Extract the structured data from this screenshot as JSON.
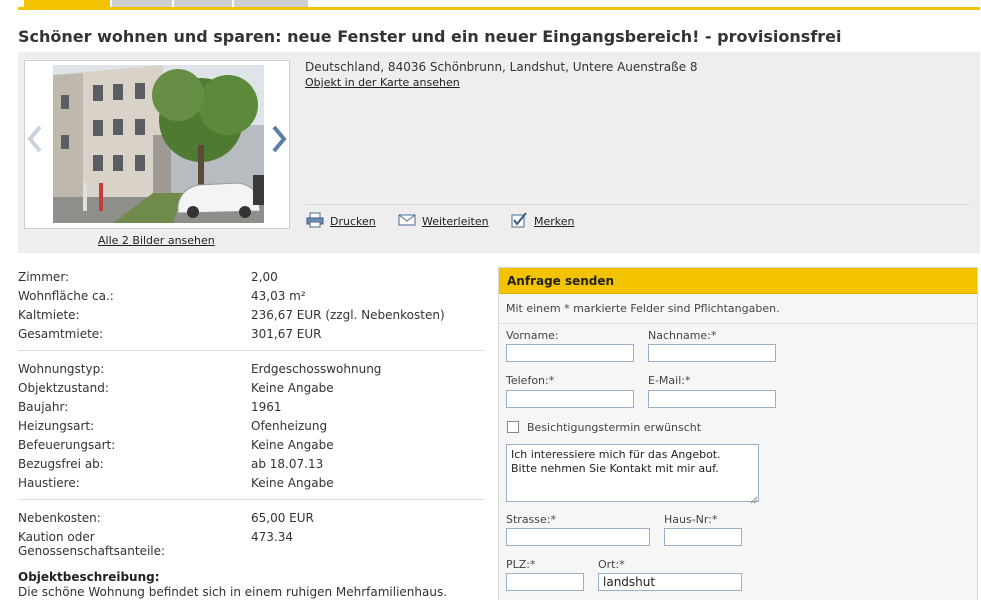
{
  "listing": {
    "title": "Schöner wohnen und sparen: neue Fenster und ein neuer Eingangsbereich! - provisionsfrei",
    "address": "Deutschland, 84036 Schönbrunn, Landshut, Untere Auenstraße 8",
    "map_link": "Objekt in der Karte ansehen",
    "all_images_link": "Alle 2 Bilder ansehen"
  },
  "actions": {
    "print": "Drucken",
    "forward": "Weiterleiten",
    "remember": "Merken"
  },
  "details": {
    "group1": [
      {
        "label": "Zimmer:",
        "value": "2,00"
      },
      {
        "label": "Wohnfläche ca.:",
        "value": "43,03 m²"
      },
      {
        "label": "Kaltmiete:",
        "value": "236,67 EUR (zzgl. Nebenkosten)"
      },
      {
        "label": "Gesamtmiete:",
        "value": "301,67 EUR"
      }
    ],
    "group2": [
      {
        "label": "Wohnungstyp:",
        "value": "Erdgeschosswohnung"
      },
      {
        "label": "Objektzustand:",
        "value": "Keine Angabe"
      },
      {
        "label": "Baujahr:",
        "value": "1961"
      },
      {
        "label": "Heizungsart:",
        "value": "Ofenheizung"
      },
      {
        "label": "Befeuerungsart:",
        "value": "Keine Angabe"
      },
      {
        "label": "Bezugsfrei ab:",
        "value": "ab 18.07.13"
      },
      {
        "label": "Haustiere:",
        "value": "Keine Angabe"
      }
    ],
    "group3": [
      {
        "label": "Nebenkosten:",
        "value": "65,00 EUR"
      },
      {
        "label": "Kaution oder Genossenschaftsanteile:",
        "value": "473.34"
      }
    ],
    "description_heading": "Objektbeschreibung:",
    "description_text": "Die schöne Wohnung befindet sich in einem ruhigen Mehrfamilienhaus."
  },
  "form": {
    "heading": "Anfrage senden",
    "required_note": "Mit einem * markierte Felder sind Pflichtangaben.",
    "firstname_label": "Vorname:",
    "lastname_label": "Nachname:*",
    "phone_label": "Telefon:*",
    "email_label": "E-Mail:*",
    "viewing_label": "Besichtigungstermin erwünscht",
    "message": "Ich interessiere mich für das Angebot.\nBitte nehmen Sie Kontakt mit mir auf.",
    "street_label": "Strasse:*",
    "housenr_label": "Haus-Nr:*",
    "zip_label": "PLZ:*",
    "city_label": "Ort:*",
    "city_value": "landshut"
  },
  "colors": {
    "accent": "#f4c300",
    "panel": "#eeeeee",
    "input_border": "#9ab0c8"
  }
}
